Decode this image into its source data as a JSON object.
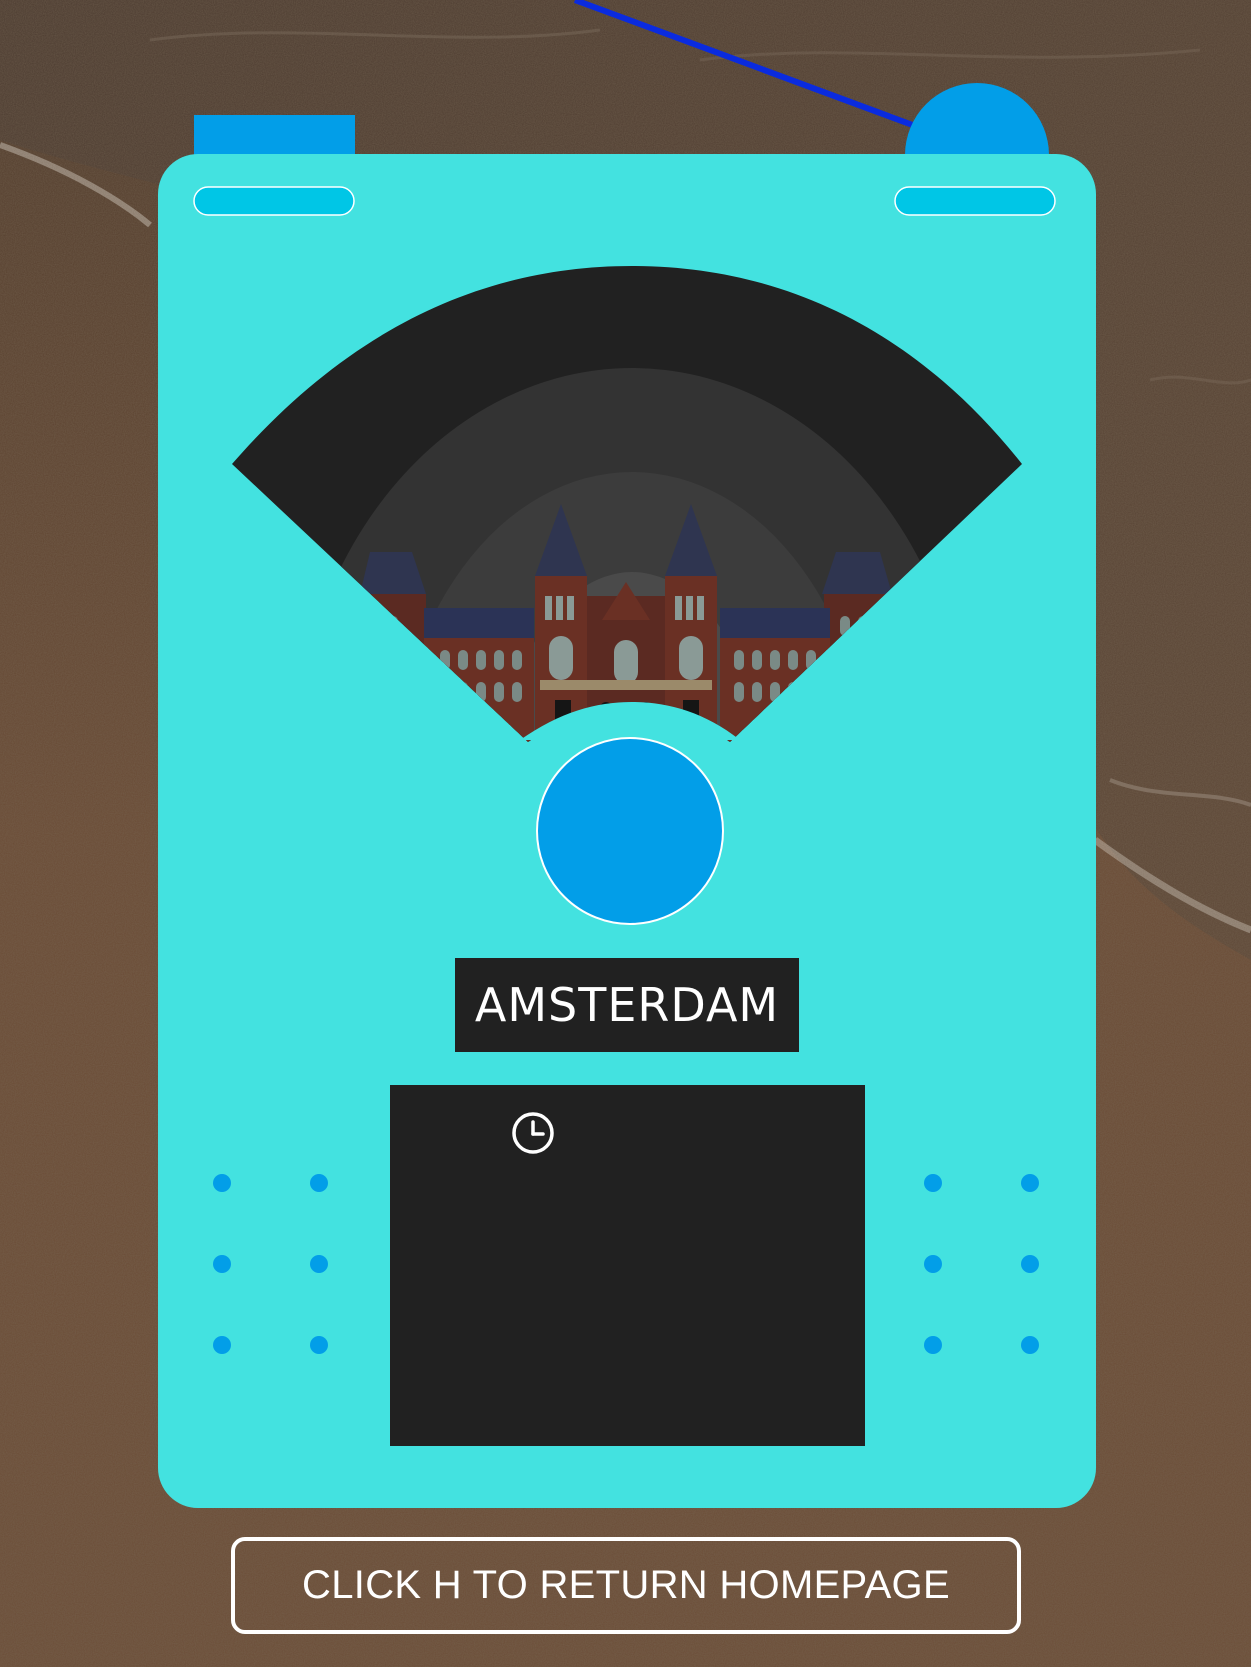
{
  "radio": {
    "city_name": "AMSTERDAM"
  },
  "home_button": {
    "label": "CLICK H TO RETURN HOMEPAGE"
  },
  "colors": {
    "radio_body": "#43E2E0",
    "accent_blue": "#029EE8",
    "pill_cyan": "#00C6E6",
    "antenna": "#0A2BDF",
    "dark_panel": "#212121"
  },
  "icons": {
    "clock": "clock-icon",
    "speaker_dots": "speaker-grille"
  }
}
